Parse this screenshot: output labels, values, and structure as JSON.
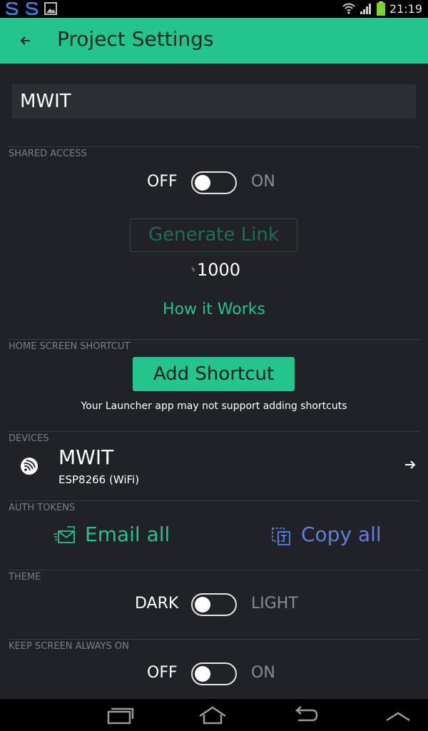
{
  "status_bar": {
    "time": "21:19",
    "icons": [
      "s-notification-icon",
      "s-notification-icon",
      "image-icon",
      "wifi-icon",
      "signal-icon",
      "battery-icon"
    ]
  },
  "header": {
    "title": "Project Settings",
    "background": "#23c48e"
  },
  "project": {
    "name": "MWIT"
  },
  "shared_access": {
    "section_label": "SHARED ACCESS",
    "off_label": "OFF",
    "on_label": "ON",
    "enabled": false,
    "generate_link_label": "Generate Link",
    "energy_symbol": "ϟ",
    "energy_cost": "1000",
    "how_it_works_label": "How it Works"
  },
  "home_shortcut": {
    "section_label": "HOME SCREEN SHORTCUT",
    "button_label": "Add Shortcut",
    "hint": "Your Launcher app may not support adding shortcuts"
  },
  "devices": {
    "section_label": "DEVICES",
    "items": [
      {
        "name": "MWIT",
        "type": "ESP8266 (WiFi)",
        "icon": "espressif-icon"
      }
    ]
  },
  "auth_tokens": {
    "section_label": "AUTH TOKENS",
    "email_all_label": "Email all",
    "copy_all_label": "Copy all",
    "email_color": "#23c48e",
    "copy_color": "#5e80d6"
  },
  "theme": {
    "section_label": "THEME",
    "off_label": "DARK",
    "on_label": "LIGHT",
    "enabled": false
  },
  "keep_screen_on": {
    "section_label": "KEEP SCREEN ALWAYS ON",
    "off_label": "OFF",
    "on_label": "ON",
    "enabled": false
  },
  "nav_bar": {
    "buttons": [
      "recent-apps-icon",
      "home-icon",
      "back-icon",
      "menu-up-icon"
    ]
  }
}
